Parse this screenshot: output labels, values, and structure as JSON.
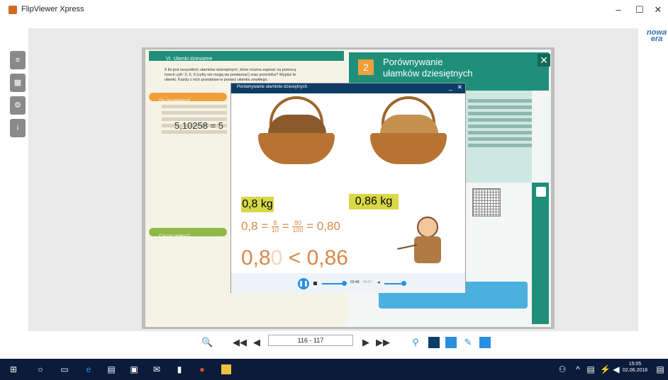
{
  "window": {
    "title": "FlipViewer Xpress",
    "minimize": "–",
    "maximize": "☐",
    "close": "✕"
  },
  "logo": {
    "line1": "nowa",
    "line2": "era"
  },
  "sidetabs": [
    {
      "icon": "list-icon",
      "glyph": "≡"
    },
    {
      "icon": "search-thumbs-icon",
      "glyph": "▦"
    },
    {
      "icon": "settings-icon",
      "glyph": "⚙"
    },
    {
      "icon": "info-icon",
      "glyph": "i"
    }
  ],
  "left_page": {
    "header": "VI. Ułamki dziesiętne",
    "hint": "8  Ile jest wszystkich ułamków dziesiętnych, które można zapisać za pomocą trzech cyfr: 3, 6, 9 (cyfry nie mogą się powtarzać) oraz przecinka? Wypisz te ułamki. Każdy z nich przedstaw w postaci ułamka zwykłego.",
    "section1": "Dla dociekliwych",
    "formula": "5,10258 = 5",
    "section2": "Czy już umiesz?"
  },
  "right_page": {
    "number": "2",
    "title_line1": "Porównywanie",
    "title_line2": "ułamków dziesiętnych",
    "close": "✕"
  },
  "video": {
    "title": "Porównywanie ułamków dziesiętnych",
    "minimize": "_",
    "close": "✕",
    "label1": "0,8 kg",
    "label2": "0,86 kg",
    "eq_left": "0,8 =",
    "frac1_num": "8",
    "frac1_den": "10",
    "eq_mid": "=",
    "frac2_num": "80",
    "frac2_den": "100",
    "eq_right": "= 0,80",
    "ineq_part1": "0,8",
    "ineq_faint": "0",
    "ineq_part2": " < 0,86",
    "time_current": "03:48",
    "time_total": "04:57",
    "play_glyph": "❚❚",
    "volume_glyph": "◂"
  },
  "toolbar": {
    "page_range": "116 - 117"
  }
}
